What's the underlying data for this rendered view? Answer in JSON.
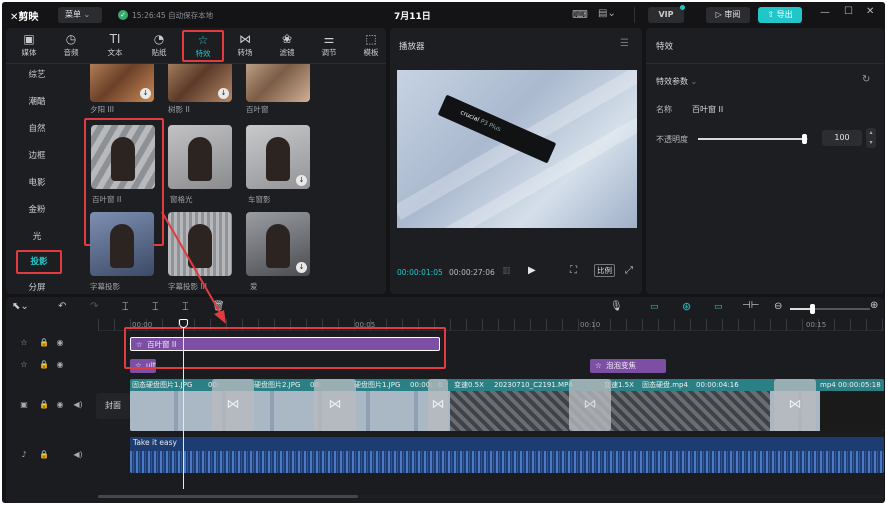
{
  "app": {
    "logo": "剪映",
    "menu": "菜单",
    "status": "15:26:45 自动保存本地",
    "project_title": "7月11日"
  },
  "top_right": {
    "vip": "VIP",
    "review": "审阅",
    "export": "导出"
  },
  "toolbar": [
    {
      "icon": "media-icon",
      "glyph": "▣",
      "label": "媒体"
    },
    {
      "icon": "audio-icon",
      "glyph": "◷",
      "label": "音频"
    },
    {
      "icon": "text-icon",
      "glyph": "TI",
      "label": "文本"
    },
    {
      "icon": "sticker-icon",
      "glyph": "◔",
      "label": "贴纸"
    },
    {
      "icon": "effects-icon",
      "glyph": "☆",
      "label": "特效"
    },
    {
      "icon": "transition-icon",
      "glyph": "⋈",
      "label": "转场"
    },
    {
      "icon": "filter-icon",
      "glyph": "❀",
      "label": "滤镜"
    },
    {
      "icon": "adjust-icon",
      "glyph": "⚌",
      "label": "调节"
    },
    {
      "icon": "template-icon",
      "glyph": "⬚",
      "label": "模板"
    }
  ],
  "categories": [
    "综艺",
    "潮酷",
    "自然",
    "边框",
    "电影",
    "金粉",
    "光",
    "投影",
    "分屏"
  ],
  "effects_grid": [
    [
      "夕阳 III",
      "树影 II",
      "百叶窗"
    ],
    [
      "百叶窗 II",
      "窗格光",
      "车窗影"
    ],
    [
      "字幕投影",
      "字幕投影 III",
      "爱"
    ]
  ],
  "player": {
    "title": "播放器",
    "current_time": "00:00:01:05",
    "total_time": "00:00:27:06",
    "ratio": "比例",
    "product_text": "crucial",
    "product_sub": "P3 Plus"
  },
  "props": {
    "tab": "特效",
    "section": "特效参数",
    "name_label": "名称",
    "name_value": "百叶窗 II",
    "opacity_label": "不透明度",
    "opacity_value": "100",
    "opacity_level": 0.96
  },
  "ruler": [
    "00:00",
    "00:05",
    "00:10",
    "00:15"
  ],
  "timeline": {
    "cover": "封面",
    "effect_clip_1": "百叶窗 II",
    "effect_clip_2": "ulti",
    "effect_clip_3": "泡泡变焦",
    "video_clips": [
      "固态硬盘图片1.JPG",
      "00:",
      "硬盘图片2.JPG",
      "00:",
      "硬盘图片1.JPG",
      "00:00:",
      "0",
      "变速0.5X",
      "20230710_C2191.MP4",
      "变速1.5X",
      "固态硬盘.mp4",
      "00:00:04:16",
      "mp4",
      "00:00:05:18"
    ],
    "audio_clip": "Take it easy"
  },
  "colors": {
    "accent": "#21c6c9",
    "effect_clip": "#7c4fa5",
    "video_bg": "#2a8085",
    "audio_bg": "#1d3d72",
    "highlight": "#e13a3f"
  }
}
